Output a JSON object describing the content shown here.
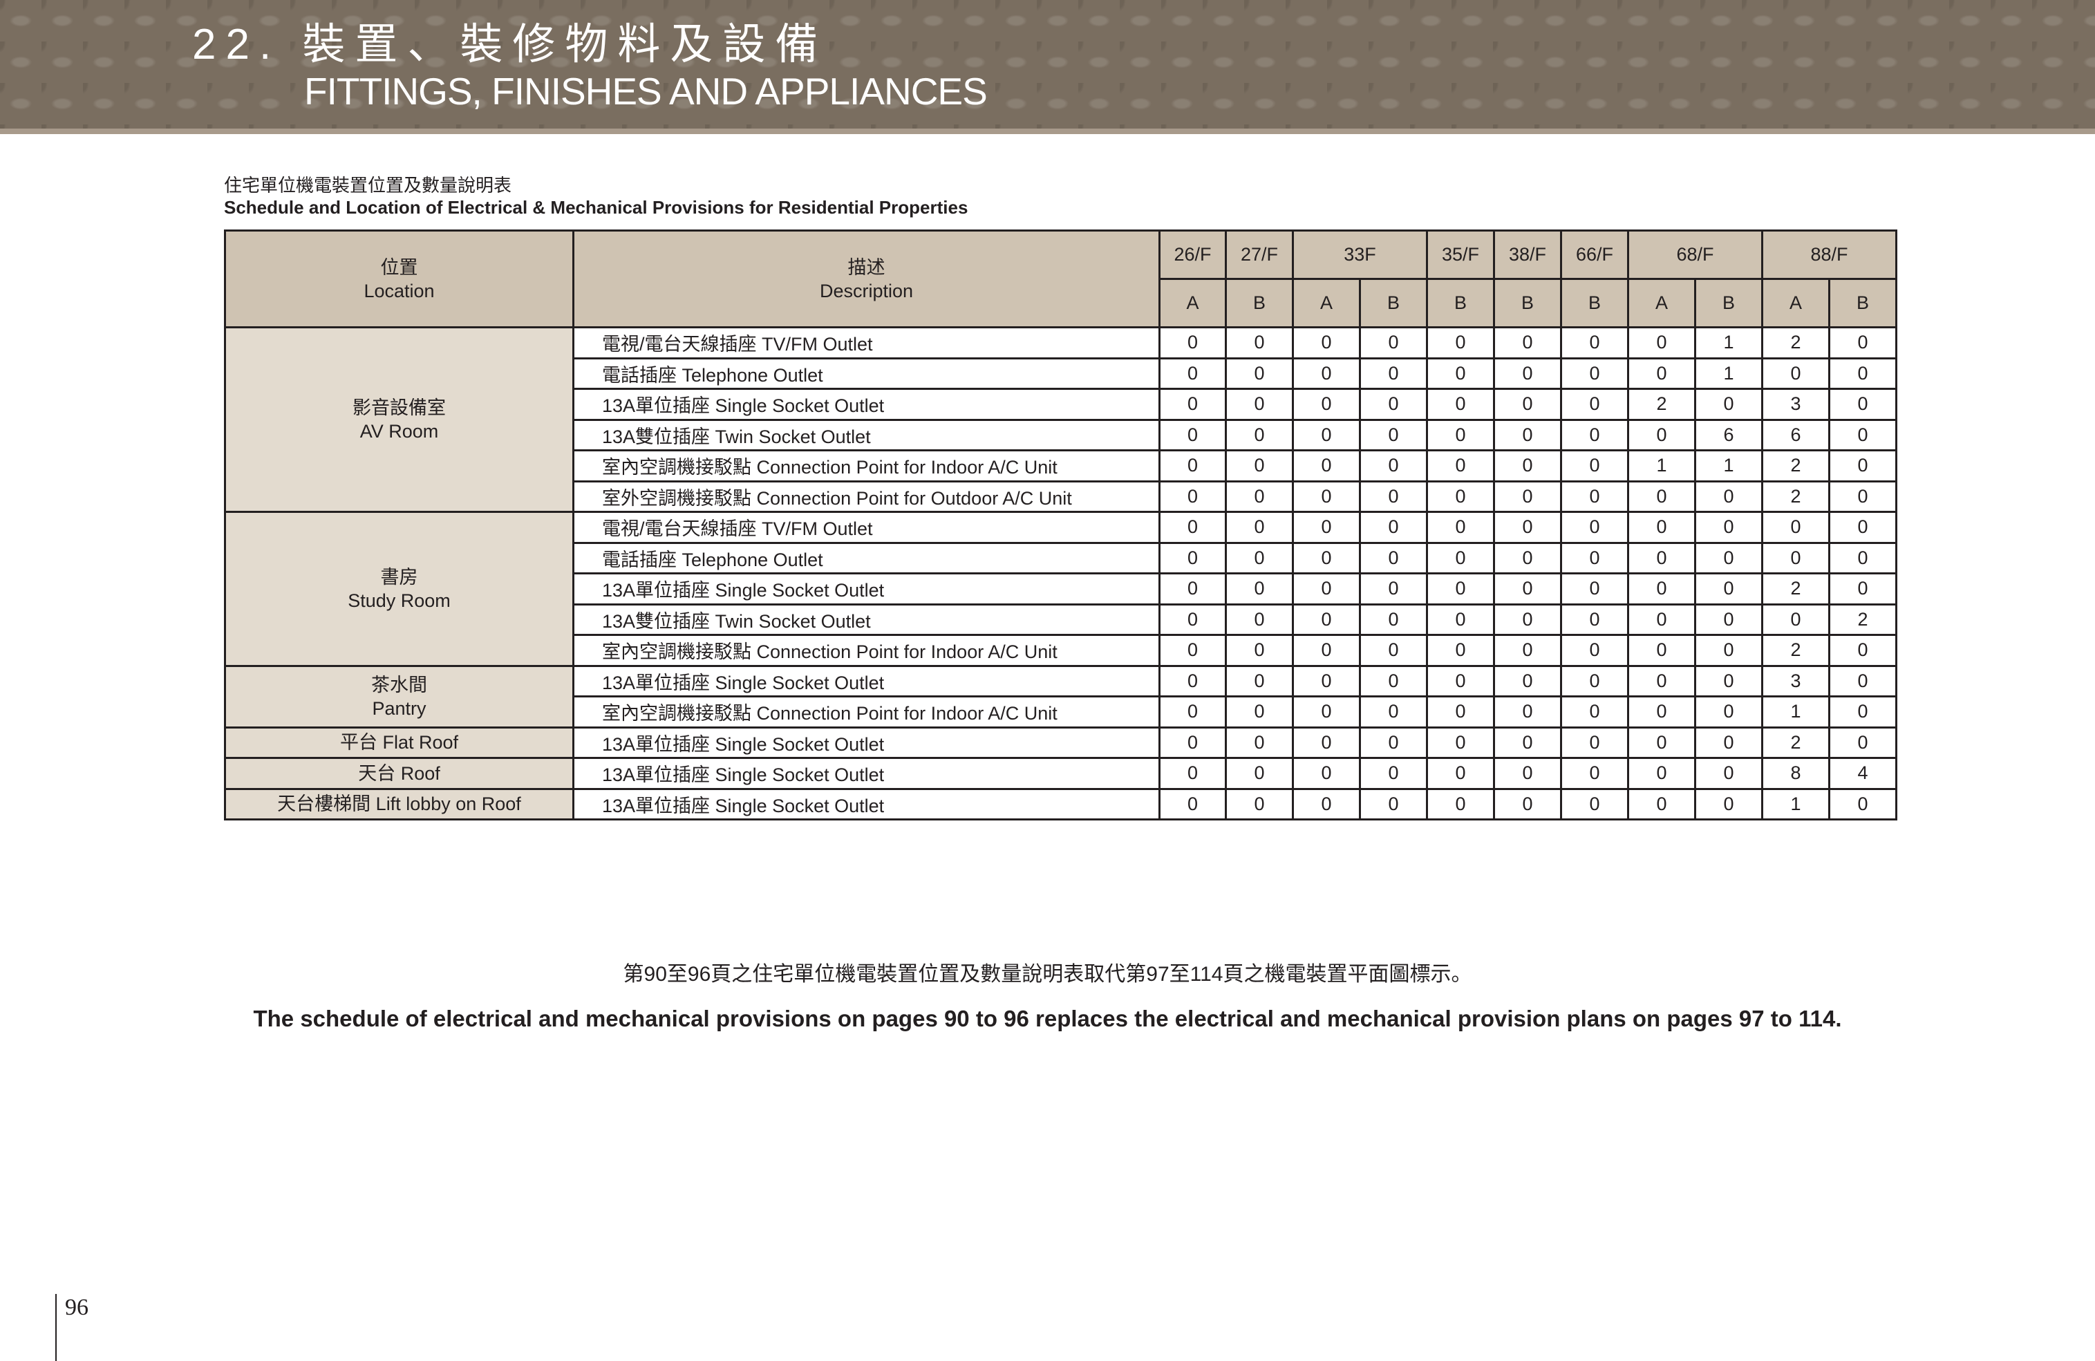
{
  "header": {
    "title_zh": "22. 裝置、裝修物料及設備",
    "title_en": "FITTINGS, FINISHES AND APPLIANCES"
  },
  "schedule": {
    "title_zh": "住宅單位機電裝置位置及數量說明表",
    "title_en": "Schedule and Location of Electrical & Mechanical Provisions for Residential Properties"
  },
  "table": {
    "location_header": {
      "zh": "位置",
      "en": "Location"
    },
    "description_header": {
      "zh": "描述",
      "en": "Description"
    },
    "floors": [
      "26/F",
      "27/F",
      "33F",
      "35/F",
      "38/F",
      "66/F",
      "68/F",
      "88/F"
    ],
    "units": [
      "A",
      "B",
      "A",
      "B",
      "B",
      "B",
      "B",
      "A",
      "B",
      "A",
      "B"
    ],
    "groups": [
      {
        "location_zh": "影音設備室",
        "location_en": "AV Room",
        "rows": [
          {
            "desc": "電視/電台天線插座 TV/FM Outlet",
            "values": [
              "0",
              "0",
              "0",
              "0",
              "0",
              "0",
              "0",
              "0",
              "1",
              "2",
              "0"
            ]
          },
          {
            "desc": "電話插座 Telephone Outlet",
            "values": [
              "0",
              "0",
              "0",
              "0",
              "0",
              "0",
              "0",
              "0",
              "1",
              "0",
              "0"
            ]
          },
          {
            "desc": "13A單位插座 Single Socket Outlet",
            "values": [
              "0",
              "0",
              "0",
              "0",
              "0",
              "0",
              "0",
              "2",
              "0",
              "3",
              "0"
            ]
          },
          {
            "desc": "13A雙位插座 Twin Socket Outlet",
            "values": [
              "0",
              "0",
              "0",
              "0",
              "0",
              "0",
              "0",
              "0",
              "6",
              "6",
              "0"
            ]
          },
          {
            "desc": "室內空調機接駁點 Connection Point for Indoor A/C Unit",
            "values": [
              "0",
              "0",
              "0",
              "0",
              "0",
              "0",
              "0",
              "1",
              "1",
              "2",
              "0"
            ]
          },
          {
            "desc": "室外空調機接駁點 Connection Point for Outdoor A/C Unit",
            "values": [
              "0",
              "0",
              "0",
              "0",
              "0",
              "0",
              "0",
              "0",
              "0",
              "2",
              "0"
            ]
          }
        ]
      },
      {
        "location_zh": "書房",
        "location_en": "Study Room",
        "rows": [
          {
            "desc": "電視/電台天線插座 TV/FM Outlet",
            "values": [
              "0",
              "0",
              "0",
              "0",
              "0",
              "0",
              "0",
              "0",
              "0",
              "0",
              "0"
            ]
          },
          {
            "desc": "電話插座 Telephone Outlet",
            "values": [
              "0",
              "0",
              "0",
              "0",
              "0",
              "0",
              "0",
              "0",
              "0",
              "0",
              "0"
            ]
          },
          {
            "desc": "13A單位插座 Single Socket Outlet",
            "values": [
              "0",
              "0",
              "0",
              "0",
              "0",
              "0",
              "0",
              "0",
              "0",
              "2",
              "0"
            ]
          },
          {
            "desc": "13A雙位插座 Twin Socket Outlet",
            "values": [
              "0",
              "0",
              "0",
              "0",
              "0",
              "0",
              "0",
              "0",
              "0",
              "0",
              "2"
            ]
          },
          {
            "desc": "室內空調機接駁點 Connection Point for Indoor A/C Unit",
            "values": [
              "0",
              "0",
              "0",
              "0",
              "0",
              "0",
              "0",
              "0",
              "0",
              "2",
              "0"
            ]
          }
        ]
      },
      {
        "location_zh": "茶水間",
        "location_en": "Pantry",
        "rows": [
          {
            "desc": "13A單位插座 Single Socket Outlet",
            "values": [
              "0",
              "0",
              "0",
              "0",
              "0",
              "0",
              "0",
              "0",
              "0",
              "3",
              "0"
            ]
          },
          {
            "desc": "室內空調機接駁點 Connection Point for Indoor A/C Unit",
            "values": [
              "0",
              "0",
              "0",
              "0",
              "0",
              "0",
              "0",
              "0",
              "0",
              "1",
              "0"
            ]
          }
        ]
      },
      {
        "location_zh": "平台 Flat Roof",
        "location_en": "",
        "rows": [
          {
            "desc": "13A單位插座 Single Socket Outlet",
            "values": [
              "0",
              "0",
              "0",
              "0",
              "0",
              "0",
              "0",
              "0",
              "0",
              "2",
              "0"
            ]
          }
        ]
      },
      {
        "location_zh": "天台 Roof",
        "location_en": "",
        "rows": [
          {
            "desc": "13A單位插座 Single Socket Outlet",
            "values": [
              "0",
              "0",
              "0",
              "0",
              "0",
              "0",
              "0",
              "0",
              "0",
              "8",
              "4"
            ]
          }
        ]
      },
      {
        "location_zh": "天台樓梯間 Lift lobby on Roof",
        "location_en": "",
        "rows": [
          {
            "desc": "13A單位插座 Single Socket Outlet",
            "values": [
              "0",
              "0",
              "0",
              "0",
              "0",
              "0",
              "0",
              "0",
              "0",
              "1",
              "0"
            ]
          }
        ]
      }
    ]
  },
  "notes": {
    "zh": "第90至96頁之住宅單位機電裝置位置及數量說明表取代第97至114頁之機電裝置平面圖標示。",
    "en": "The schedule of electrical and mechanical provisions on pages 90 to 96 replaces the electrical and mechanical provision plans on pages 97 to 114."
  },
  "page_number": "96",
  "colors": {
    "banner": "#7a6e60",
    "header_cell": "#cfc3b2",
    "location_cell": "#e3dbcf",
    "text": "#231f20"
  }
}
